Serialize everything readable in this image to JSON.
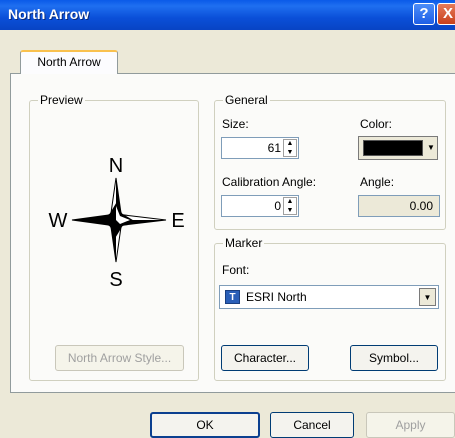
{
  "window": {
    "title": "North Arrow",
    "help_glyph": "?",
    "close_glyph": "X"
  },
  "tabs": [
    {
      "label": "North Arrow",
      "selected": true
    }
  ],
  "preview": {
    "group_title": "Preview",
    "compass_labels": {
      "n": "N",
      "s": "S",
      "e": "E",
      "w": "W"
    },
    "style_button": "North Arrow Style..."
  },
  "general": {
    "group_title": "General",
    "size_label": "Size:",
    "size_value": "61",
    "color_label": "Color:",
    "color_value": "#000000",
    "calibration_label": "Calibration Angle:",
    "calibration_value": "0",
    "angle_label": "Angle:",
    "angle_value": "0.00"
  },
  "marker": {
    "group_title": "Marker",
    "font_label": "Font:",
    "font_value": "ESRI North",
    "font_icon": "truetype-font-icon",
    "font_icon_glyph": "T",
    "character_button": "Character...",
    "symbol_button": "Symbol..."
  },
  "footer": {
    "ok": "OK",
    "cancel": "Cancel",
    "apply": "Apply"
  },
  "colors": {
    "titlebar": "#0a4fd8",
    "dialog_bg": "#ece9d8",
    "panel_bg": "#fbfbf9",
    "tab_highlight": "#f9c14e"
  }
}
